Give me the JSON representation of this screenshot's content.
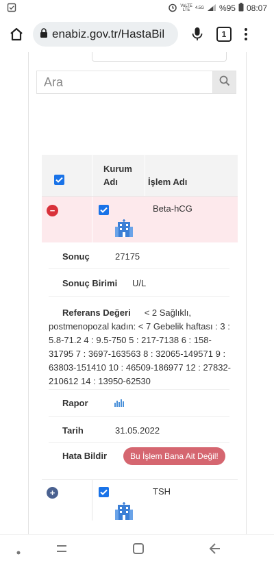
{
  "status_bar": {
    "network_top": "VoLTE",
    "network_bottom": "LTE",
    "network_gen": "4.5G",
    "battery": "%95",
    "time": "08:07"
  },
  "browser": {
    "url": "enabiz.gov.tr/HastaBil",
    "tab_count": "1"
  },
  "search": {
    "placeholder": "Ara"
  },
  "table": {
    "header": {
      "kurum_line1": "Kurum",
      "kurum_line2": "Adı",
      "islem": "İşlem Adı"
    },
    "rows": [
      {
        "name": "Beta-hCG",
        "expanded": true,
        "toggle": "−",
        "checked": true
      },
      {
        "name": "TSH",
        "expanded": false,
        "toggle": "+",
        "checked": true
      }
    ],
    "detail": {
      "sonuc_label": "Sonuç",
      "sonuc_value": "27175",
      "birim_label": "Sonuç Birimi",
      "birim_value": "U/L",
      "referans_label": "Referans Değeri",
      "referans_value": "< 2 Sağlıklı, postmenopozal kadın: < 7 Gebelik haftası : 3 : 5.8-71.2 4 : 9.5-750 5 : 217-7138 6 : 158-31795 7 : 3697-163563 8 : 32065-149571 9 : 63803-151410 10 : 46509-186977 12 : 27832-210612 14 : 13950-62530",
      "rapor_label": "Rapor",
      "tarih_label": "Tarih",
      "tarih_value": "31.05.2022",
      "hata_label": "Hata Bildir",
      "hata_button": "Bu İşlem Bana Ait Değil!"
    }
  },
  "colors": {
    "checkbox": "#1a73e8",
    "row_highlight": "#fde9ec",
    "minus_toggle": "#d9313a",
    "plus_toggle": "#4a6190",
    "report_button": "#d56670",
    "building_icon": "#3b7fd6"
  },
  "icons": {
    "home": "home-icon",
    "lock": "lock-icon",
    "mic": "mic-icon",
    "search": "search-icon",
    "building": "hospital-building-icon",
    "report": "bar-chart-icon"
  }
}
